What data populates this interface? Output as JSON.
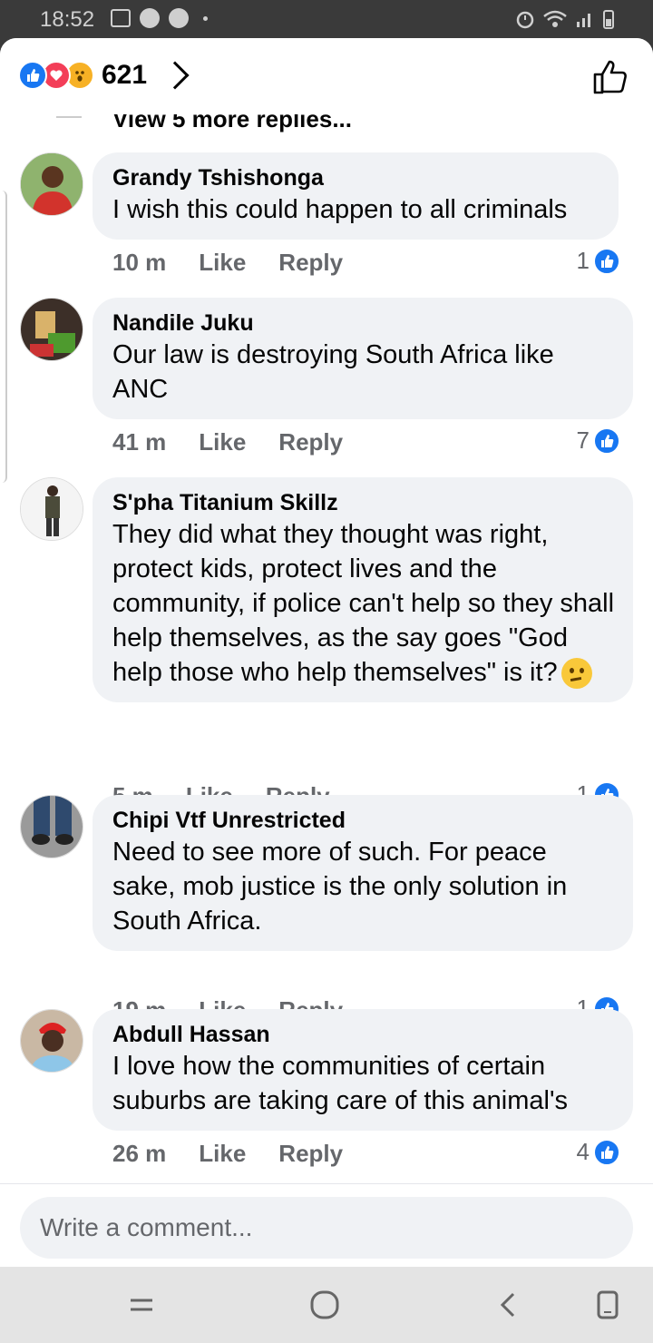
{
  "status_bar": {
    "time": "18:52"
  },
  "header": {
    "reaction_count": "621"
  },
  "view_more": "View 5 more replies...",
  "comments": [
    {
      "author": "Grandy Tshishonga",
      "text": "I wish this could happen to all criminals",
      "time": "10 m",
      "like": "Like",
      "reply": "Reply",
      "likes": "1"
    },
    {
      "author": "Nandile Juku",
      "text": "Our law is destroying South Africa like ANC",
      "time": "41 m",
      "like": "Like",
      "reply": "Reply",
      "likes": "7"
    },
    {
      "author": "S'pha Titanium Skillz",
      "text": "They did what they thought was right, protect kids, protect lives and the community, if police can't help so they shall help themselves, as the say goes \"God help those who help themselves\" is it?",
      "emoji": "thinking-face",
      "time": "5 m",
      "like": "Like",
      "reply": "Reply",
      "likes": "1"
    },
    {
      "author": "Chipi Vtf Unrestricted",
      "text": "Need to see more of such. For peace sake, mob justice is the only solution in South Africa.",
      "time": "19 m",
      "like": "Like",
      "reply": "Reply",
      "likes": "1"
    },
    {
      "author": "Abdull Hassan",
      "text": "I love how the communities of certain suburbs are taking care of this animal's",
      "time": "26 m",
      "like": "Like",
      "reply": "Reply",
      "likes": "4"
    }
  ],
  "composer": {
    "placeholder": "Write a comment..."
  },
  "colors": {
    "brand": "#1877f2",
    "bubble": "#f0f2f5",
    "meta": "#65676b"
  }
}
